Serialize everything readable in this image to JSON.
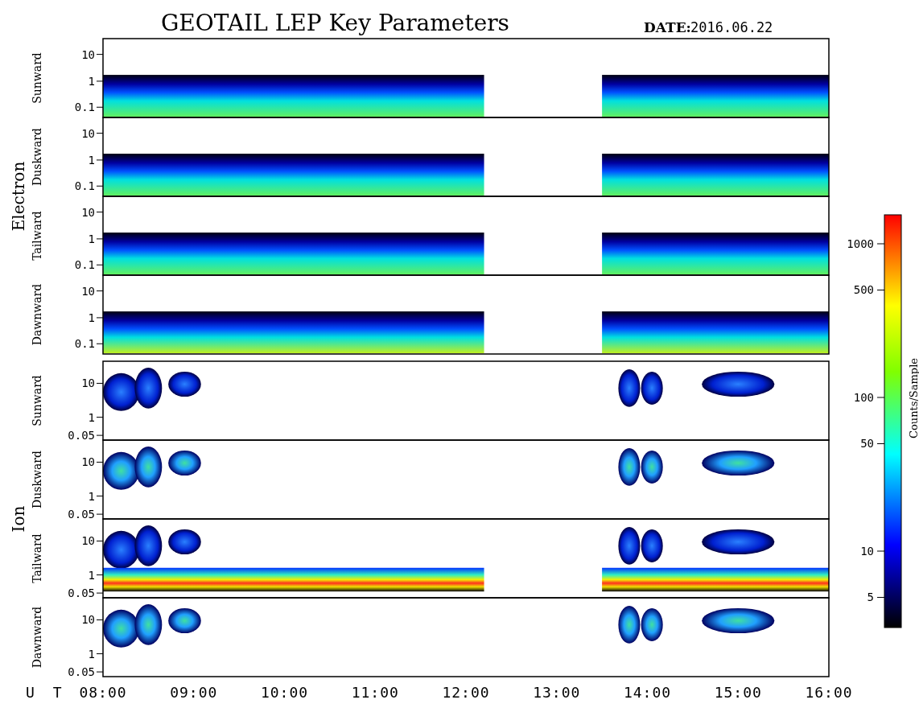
{
  "title": "GEOTAIL LEP Key Parameters",
  "date_label": "DATE:",
  "date": "2016.06.22",
  "groups": [
    {
      "species": "Electron",
      "panels": [
        {
          "direction": "Sunward",
          "yticks": [
            "10",
            "1",
            "0.1"
          ]
        },
        {
          "direction": "Duskward",
          "yticks": [
            "10",
            "1",
            "0.1"
          ]
        },
        {
          "direction": "Tailward",
          "yticks": [
            "10",
            "1",
            "0.1"
          ]
        },
        {
          "direction": "Dawnward",
          "yticks": [
            "10",
            "1",
            "0.1"
          ]
        }
      ]
    },
    {
      "species": "Ion",
      "panels": [
        {
          "direction": "Sunward",
          "yticks": [
            "10",
            "1",
            "0.05"
          ]
        },
        {
          "direction": "Duskward",
          "yticks": [
            "10",
            "1",
            "0.05"
          ]
        },
        {
          "direction": "Tailward",
          "yticks": [
            "10",
            "1",
            "0.05"
          ]
        },
        {
          "direction": "Dawnward",
          "yticks": [
            "10",
            "1",
            "0.05"
          ]
        }
      ]
    }
  ],
  "x_axis": {
    "label": "U T",
    "ticks": [
      "08:00",
      "09:00",
      "10:00",
      "11:00",
      "12:00",
      "13:00",
      "14:00",
      "15:00",
      "16:00"
    ]
  },
  "colorbar": {
    "label": "Counts/Sample",
    "ticks": [
      "1000",
      "500",
      "100",
      "50",
      "10",
      "5"
    ]
  }
}
